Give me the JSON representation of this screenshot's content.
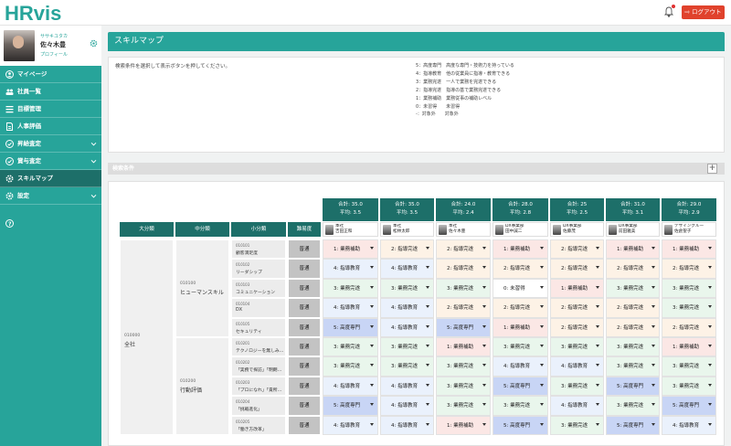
{
  "app": {
    "logo_text": "HRvis",
    "logout_label": "ログアウト"
  },
  "profile": {
    "ruby": "ササキユタカ",
    "name": "佐々木豊",
    "link": "プロフィール"
  },
  "nav": [
    {
      "label": "マイページ",
      "icon": "user-circle-icon"
    },
    {
      "label": "社員一覧",
      "icon": "users-icon"
    },
    {
      "label": "目標管理",
      "icon": "list-icon"
    },
    {
      "label": "人事評価",
      "icon": "document-icon"
    },
    {
      "label": "昇給査定",
      "icon": "check-circle-icon"
    },
    {
      "label": "賞与査定",
      "icon": "check-circle-icon"
    },
    {
      "label": "スキルマップ",
      "icon": "gear-icon"
    },
    {
      "label": "設定",
      "icon": "gear-icon"
    },
    {
      "label": "",
      "icon": "help-icon"
    }
  ],
  "page": {
    "title": "スキルマップ",
    "instruction": "検索条件を選択して表示ボタンを押してください。",
    "legend": [
      "5：高度専門　高度な専門・技術力を持っている",
      "4：指導教育　他の従業員に指導・教育できる",
      "3：業務完遂　一人で業務を完遂できる",
      "2：指導完遂　指導の基で業務完遂できる",
      "1：業務補助　業務従事の補助レベル",
      "0：未習得　　未習得",
      "-：対象外　　対象外"
    ],
    "search_label": "検索条件",
    "search_toggle": "+"
  },
  "table": {
    "headers": {
      "major": "大分類",
      "middle": "中分類",
      "minor": "小分類",
      "difficulty": "難易度"
    },
    "major": {
      "code": "010000",
      "name": "全社"
    },
    "middle": [
      {
        "code": "010100",
        "name": "ヒューマンスキル"
      },
      {
        "code": "010200",
        "name": "行動評価"
      }
    ],
    "rows": [
      {
        "code": "010101",
        "name": "顧客満足度",
        "difficulty": "普通"
      },
      {
        "code": "010102",
        "name": "リーダシップ",
        "difficulty": "普通"
      },
      {
        "code": "010103",
        "name": "コミュニケーション",
        "difficulty": "普通"
      },
      {
        "code": "010104",
        "name": "DX",
        "difficulty": "普通"
      },
      {
        "code": "010105",
        "name": "セキュリティ",
        "difficulty": "普通"
      },
      {
        "code": "010201",
        "name": "テクノロジーを無しみ…",
        "difficulty": "普通"
      },
      {
        "code": "010202",
        "name": "「実務で探訪」「明朗…",
        "difficulty": "普通"
      },
      {
        "code": "010203",
        "name": "「プロになれ」「責所…",
        "difficulty": "普通"
      },
      {
        "code": "010204",
        "name": "「挑戦進化」",
        "difficulty": "普通"
      },
      {
        "code": "010205",
        "name": "「働き方改革」",
        "difficulty": "普通"
      }
    ],
    "employees": [
      {
        "total": "合計: 35.0",
        "avg": "平均: 3.5",
        "dept": "本社",
        "name": "吉田正和"
      },
      {
        "total": "合計: 35.0",
        "avg": "平均: 3.5",
        "dept": "本社",
        "name": "松林太郎"
      },
      {
        "total": "合計: 24.0",
        "avg": "平均: 2.4",
        "dept": "本社",
        "name": "佐々木豊"
      },
      {
        "total": "合計: 28.0",
        "avg": "平均: 2.8",
        "dept": "DX事業部",
        "name": "田中誠二"
      },
      {
        "total": "合計: 25",
        "avg": "平均: 2.5",
        "dept": "DX事業部",
        "name": "佐藤茂"
      },
      {
        "total": "合計: 31.0",
        "avg": "平均: 3.1",
        "dept": "DX事業部",
        "name": "前田雅美"
      },
      {
        "total": "合計: 29.0",
        "avg": "平均: 2.9",
        "dept": "デザイングルー",
        "name": "佐倉聖子"
      }
    ],
    "scores": [
      [
        "1: 業務補助",
        "2: 指導完遂",
        "2: 指導完遂",
        "1: 業務補助",
        "2: 指導完遂",
        "1: 業務補助",
        "1: 業務補助"
      ],
      [
        "4: 指導教育",
        "4: 指導教育",
        "2: 指導完遂",
        "2: 指導完遂",
        "2: 指導完遂",
        "2: 指導完遂",
        "2: 指導完遂"
      ],
      [
        "3: 業務完遂",
        "3: 業務完遂",
        "3: 業務完遂",
        "0: 未習得",
        "1: 業務補助",
        "3: 業務完遂",
        "3: 業務完遂"
      ],
      [
        "4: 指導教育",
        "4: 指導教育",
        "2: 指導完遂",
        "2: 指導完遂",
        "2: 指導完遂",
        "2: 指導完遂",
        "3: 業務完遂"
      ],
      [
        "5: 高度専門",
        "4: 指導教育",
        "5: 高度専門",
        "1: 業務補助",
        "2: 指導完遂",
        "2: 指導完遂",
        "2: 指導完遂"
      ],
      [
        "3: 業務完遂",
        "3: 業務完遂",
        "1: 業務補助",
        "3: 業務完遂",
        "3: 業務完遂",
        "3: 業務完遂",
        "1: 業務補助"
      ],
      [
        "3: 業務完遂",
        "3: 業務完遂",
        "3: 業務完遂",
        "4: 指導教育",
        "4: 指導教育",
        "3: 業務完遂",
        "3: 業務完遂"
      ],
      [
        "4: 指導教育",
        "4: 指導教育",
        "3: 業務完遂",
        "5: 高度専門",
        "3: 業務完遂",
        "5: 高度専門",
        "3: 業務完遂"
      ],
      [
        "5: 高度専門",
        "4: 指導教育",
        "3: 業務完遂",
        "3: 業務完遂",
        "4: 指導教育",
        "3: 業務完遂",
        "5: 高度専門"
      ],
      [
        "4: 指導教育",
        "4: 指導教育",
        "1: 業務補助",
        "5: 高度専門",
        "3: 業務完遂",
        "5: 高度専門",
        "4: 指導教育"
      ]
    ]
  },
  "colors": {
    "teal": "#27a49a",
    "dark_teal": "#1d6f69",
    "logout_red": "#e0422c",
    "level_5": "#c8d5f5",
    "level_4": "#eaf1fc",
    "level_3": "#e9f6ec",
    "level_2": "#fdf2e6",
    "level_1": "#fbe7e5",
    "level_0": "#ffffff"
  }
}
